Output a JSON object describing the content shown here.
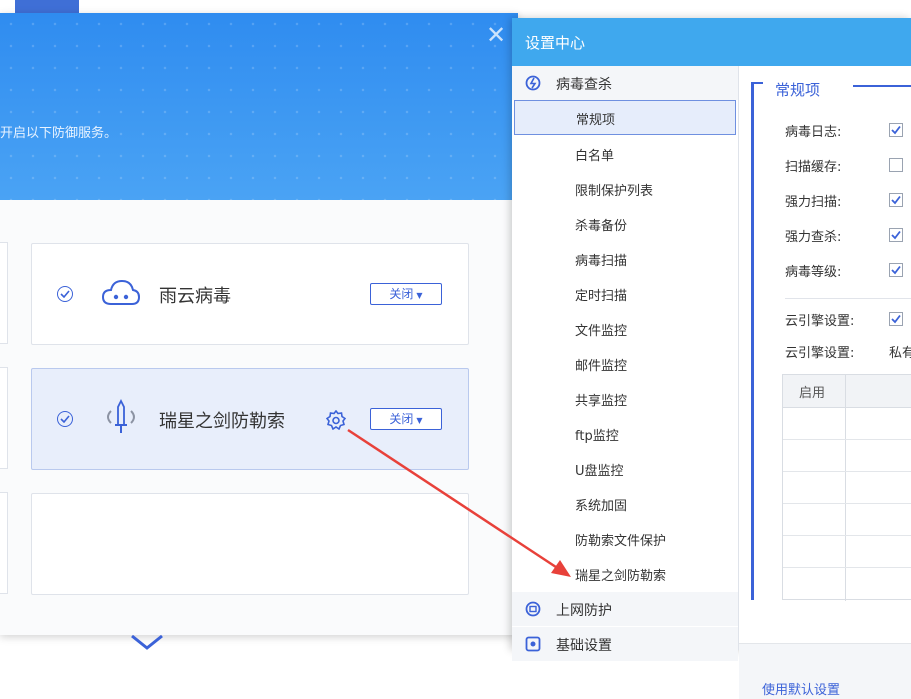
{
  "background_window": {
    "header_text": "开启以下防御服务。",
    "close_icon": "close-icon",
    "cards": [
      {
        "name": "雨云病毒",
        "icon": "cloud-icon",
        "button": "关闭"
      },
      {
        "name": "瑞星之剑防勒索",
        "icon": "sword-icon",
        "settings_icon": "gear-icon",
        "button": "关闭"
      }
    ]
  },
  "settings": {
    "title": "设置中心",
    "groups": [
      {
        "label": "病毒查杀",
        "icon": "virus-scan-icon"
      },
      {
        "label": "上网防护",
        "icon": "web-shield-icon"
      },
      {
        "label": "基础设置",
        "icon": "basic-settings-icon"
      }
    ],
    "items": [
      "常规项",
      "白名单",
      "限制保护列表",
      "杀毒备份",
      "病毒扫描",
      "定时扫描",
      "文件监控",
      "邮件监控",
      "共享监控",
      "ftp监控",
      "U盘监控",
      "系统加固",
      "防勒索文件保护",
      "瑞星之剑防勒索"
    ],
    "selected_item": "常规项",
    "section_title": "常规项",
    "options": [
      {
        "label": "病毒日志:",
        "checked": true
      },
      {
        "label": "扫描缓存:",
        "checked": false
      },
      {
        "label": "强力扫描:",
        "checked": true
      },
      {
        "label": "强力查杀:",
        "checked": true
      },
      {
        "label": "病毒等级:",
        "checked": true
      },
      {
        "label": "云引擎设置:",
        "checked": true
      },
      {
        "label": "云引擎设置:",
        "value": "私有"
      }
    ],
    "table_header": "启用",
    "default_link": "使用默认设置"
  },
  "colors": {
    "accent": "#3b62d8",
    "title_bar": "#3fa8ee",
    "header_blue": "#2f8cf0",
    "arrow": "#e8413a"
  }
}
